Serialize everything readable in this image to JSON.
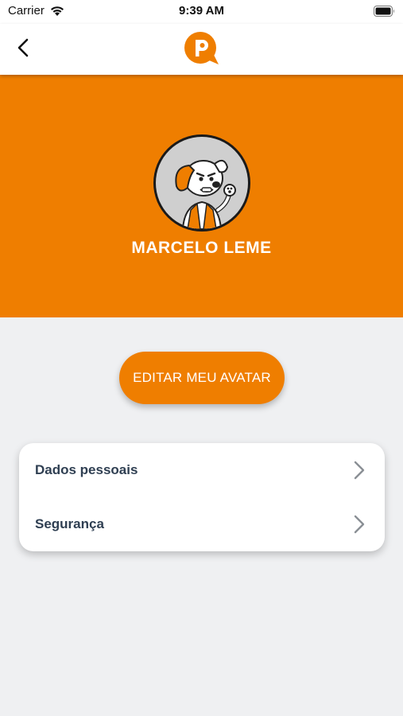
{
  "status_bar": {
    "carrier": "Carrier",
    "time": "9:39 AM"
  },
  "nav": {
    "back_icon": "chevron-left-icon",
    "logo_icon": "p-speech-bubble-logo",
    "brand_color": "#ef7e00"
  },
  "profile": {
    "name": "MARCELO LEME",
    "avatar_icon": "dog-mascot-avatar"
  },
  "edit_avatar": {
    "label": "EDITAR MEU AVATAR"
  },
  "menu": {
    "items": [
      {
        "label": "Dados pessoais",
        "icon": "chevron-right-icon"
      },
      {
        "label": "Segurança",
        "icon": "chevron-right-icon"
      }
    ]
  },
  "colors": {
    "accent": "#ef7e00",
    "background": "#eff0f2",
    "card": "#ffffff",
    "menu_text": "#2f3f52"
  }
}
